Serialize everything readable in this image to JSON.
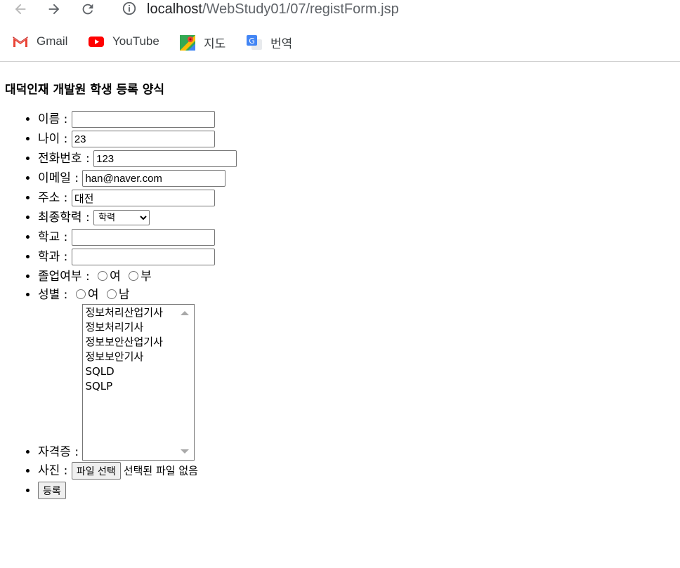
{
  "browser": {
    "url_host": "localhost",
    "url_path": "/WebStudy01/07/registForm.jsp",
    "bookmarks": [
      {
        "label": "Gmail",
        "icon": "gmail-icon"
      },
      {
        "label": "YouTube",
        "icon": "youtube-icon"
      },
      {
        "label": "지도",
        "icon": "maps-icon"
      },
      {
        "label": "번역",
        "icon": "translate-icon"
      }
    ]
  },
  "page": {
    "title": "대덕인재 개발원 학생 등록 양식"
  },
  "form": {
    "name_label": "이름 :",
    "name_value": "",
    "age_label": "나이 :",
    "age_value": "23",
    "phone_label": "전화번호 :",
    "phone_value": "123",
    "email_label": "이메일 :",
    "email_value": "han@naver.com",
    "address_label": "주소 :",
    "address_value": "대전",
    "education_label": "최종학력 :",
    "education_selected": "학력",
    "school_label": "학교 :",
    "school_value": "",
    "major_label": "학과 :",
    "major_value": "",
    "graduation_label": "졸업여부 :",
    "graduation_options": [
      "여",
      "부"
    ],
    "gender_label": "성별 :",
    "gender_options": [
      "여",
      "남"
    ],
    "license_label": "자격증 :",
    "license_options": [
      "정보처리산업기사",
      "정보처리기사",
      "정보보안산업기사",
      "정보보안기사",
      "SQLD",
      "SQLP"
    ],
    "photo_label": "사진 :",
    "file_button": "파일 선택",
    "file_status": "선택된 파일 없음",
    "submit_label": "등록"
  }
}
